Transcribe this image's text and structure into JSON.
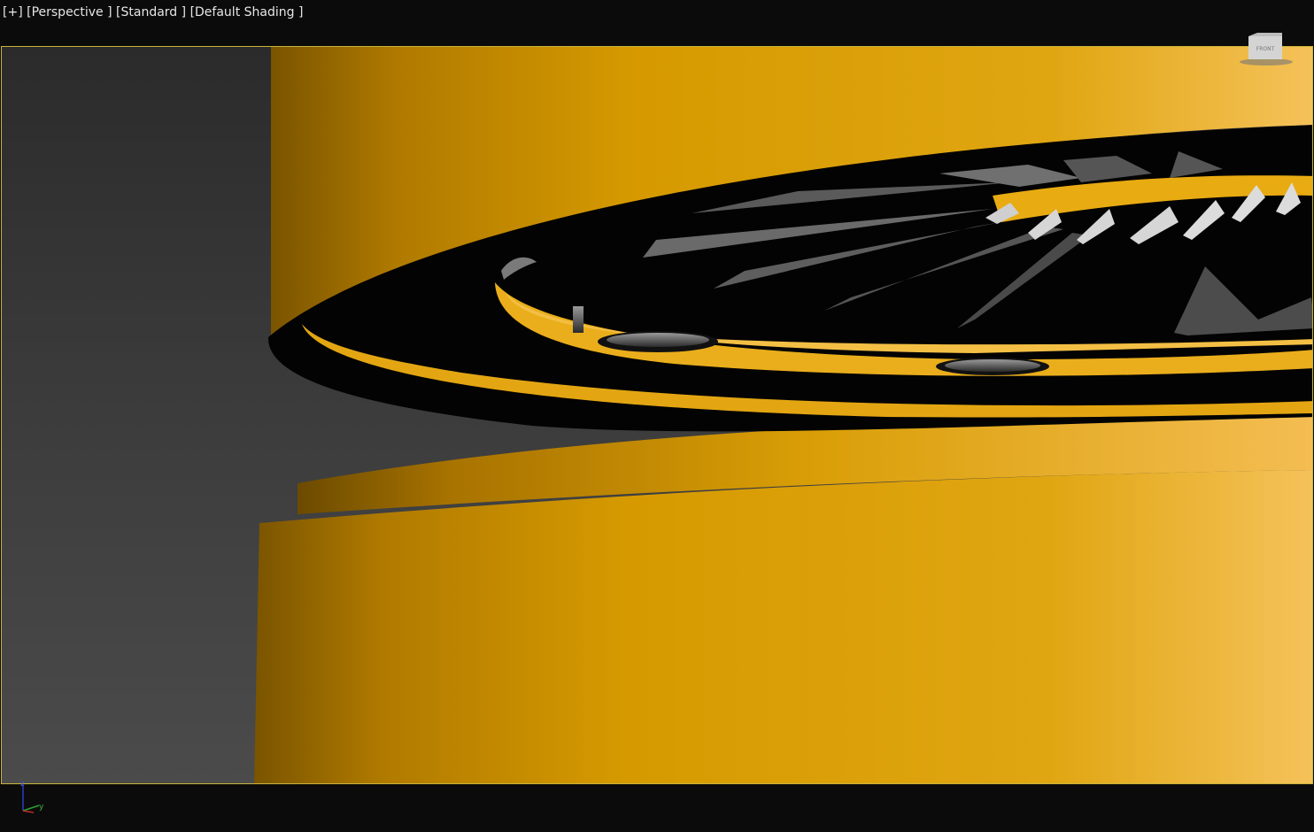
{
  "viewport": {
    "label_plus": "[+]",
    "label_view": "[Perspective ]",
    "label_standard": "[Standard ]",
    "label_shading": "[Default Shading ]"
  },
  "viewcube": {
    "icon": "viewcube-icon",
    "face_label": "FRONT"
  },
  "gizmo": {
    "icon": "axis-tripod-icon",
    "z_label": "z",
    "y_label": "y"
  },
  "colors": {
    "viewport_border": "#c9b33a",
    "object_yellow": "#e0a50a",
    "background_top": "#2b2b2b",
    "background_bottom": "#4b4b4b"
  }
}
